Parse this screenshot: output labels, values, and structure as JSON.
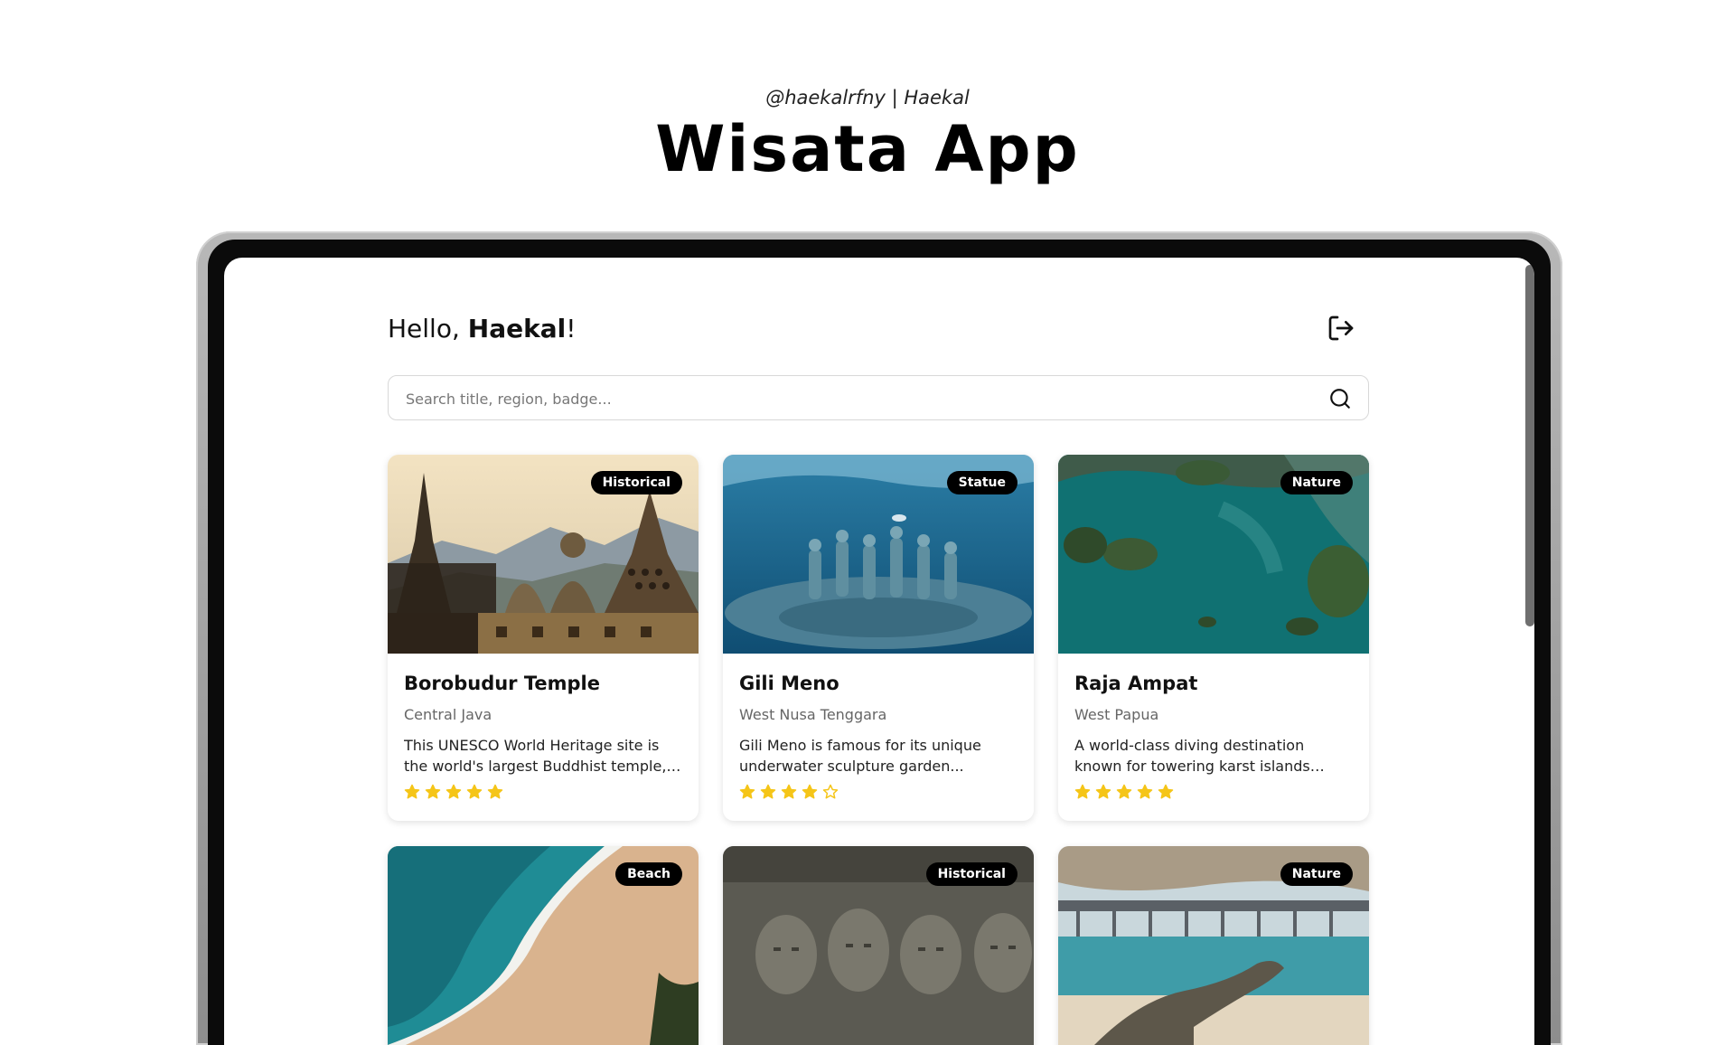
{
  "header": {
    "author": "@haekalrfny | Haekal",
    "app_title": "Wisata App"
  },
  "app": {
    "greeting_prefix": "Hello, ",
    "user_name": "Haekal",
    "greeting_suffix": "!",
    "search_placeholder": "Search title, region, badge...",
    "search_value": ""
  },
  "icons": {
    "logout": "logout-icon",
    "search": "search-icon",
    "star": "star-icon"
  },
  "colors": {
    "star": "#f5c518",
    "badge_bg": "#000000"
  },
  "destinations": [
    {
      "title": "Borobudur Temple",
      "region": "Central Java",
      "badge": "Historical",
      "description": "This UNESCO World Heritage site is the world's largest Buddhist temple, built...",
      "rating": 5
    },
    {
      "title": "Gili Meno",
      "region": "West Nusa Tenggara",
      "badge": "Statue",
      "description": "Gili Meno is famous for its unique underwater sculpture garden...",
      "rating": 4
    },
    {
      "title": "Raja Ampat",
      "region": "West Papua",
      "badge": "Nature",
      "description": "A world-class diving destination known for towering karst islands and...",
      "rating": 5
    },
    {
      "badge": "Beach"
    },
    {
      "badge": "Historical"
    },
    {
      "badge": "Nature"
    }
  ]
}
